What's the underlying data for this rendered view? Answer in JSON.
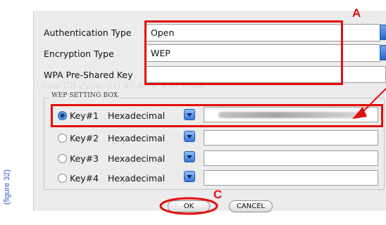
{
  "figure_label": "(figure 32)",
  "fields": {
    "auth_type": {
      "label": "Authentication Type",
      "value": "Open"
    },
    "encryption_type": {
      "label": "Encryption Type",
      "value": "WEP"
    },
    "wpa_key": {
      "label": "WPA Pre-Shared Key",
      "value": ""
    }
  },
  "wep_box": {
    "title": "WEP SETTING BOX",
    "keys": [
      {
        "label": "Key#1",
        "format": "Hexadecimal",
        "selected": true,
        "value": ""
      },
      {
        "label": "Key#2",
        "format": "Hexadecimal",
        "selected": false,
        "value": ""
      },
      {
        "label": "Key#3",
        "format": "Hexadecimal",
        "selected": false,
        "value": ""
      },
      {
        "label": "Key#4",
        "format": "Hexadecimal",
        "selected": false,
        "value": ""
      }
    ]
  },
  "buttons": {
    "ok": "OK",
    "cancel": "CANCEL"
  },
  "annotations": {
    "a": "A",
    "c": "C"
  },
  "watermark": "Louis CB Zysal GO 62 A1 8 5 52 Infra",
  "accent_color": "#e30d0d"
}
